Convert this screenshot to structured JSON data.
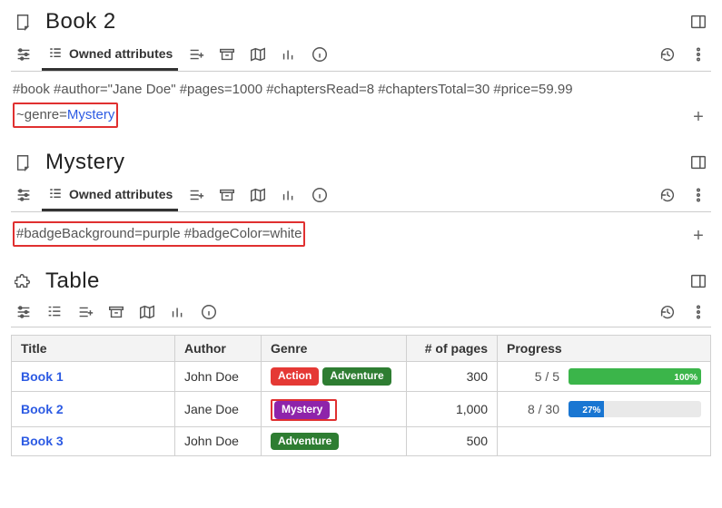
{
  "sections": {
    "book2": {
      "title": "Book 2",
      "tab_label": "Owned attributes",
      "attrs_plain": "#book #author=\"Jane Doe\" #pages=1000 #chaptersRead=8 #chaptersTotal=30 #price=59.99",
      "attrs_callout_prefix": "~genre=",
      "attrs_callout_link": "Mystery"
    },
    "mystery": {
      "title": "Mystery",
      "tab_label": "Owned attributes",
      "attrs_callout": "#badgeBackground=purple #badgeColor=white"
    },
    "table": {
      "title": "Table",
      "columns": [
        "Title",
        "Author",
        "Genre",
        "# of pages",
        "Progress"
      ],
      "rows": [
        {
          "title": "Book 1",
          "author": "John Doe",
          "genres": [
            {
              "label": "Action",
              "bg": "#e53935",
              "fg": "#ffffff"
            },
            {
              "label": "Adventure",
              "bg": "#2e7d32",
              "fg": "#ffffff"
            }
          ],
          "genre_callout": false,
          "pages": "300",
          "progress": {
            "read": "5",
            "total": "5",
            "pct": 100,
            "pct_label": "100%",
            "bar_bg": "#3bb54a"
          }
        },
        {
          "title": "Book 2",
          "author": "Jane Doe",
          "genres": [
            {
              "label": "Mystery",
              "bg": "#8e24aa",
              "fg": "#ffffff"
            }
          ],
          "genre_callout": true,
          "pages": "1,000",
          "progress": {
            "read": "8",
            "total": "30",
            "pct": 27,
            "pct_label": "27%",
            "bar_bg": "#1976d2"
          }
        },
        {
          "title": "Book 3",
          "author": "John Doe",
          "genres": [
            {
              "label": "Adventure",
              "bg": "#2e7d32",
              "fg": "#ffffff"
            }
          ],
          "genre_callout": false,
          "pages": "500",
          "progress": null
        }
      ]
    }
  },
  "colors": {
    "callout_border": "#e03030",
    "link": "#2d5be3"
  }
}
